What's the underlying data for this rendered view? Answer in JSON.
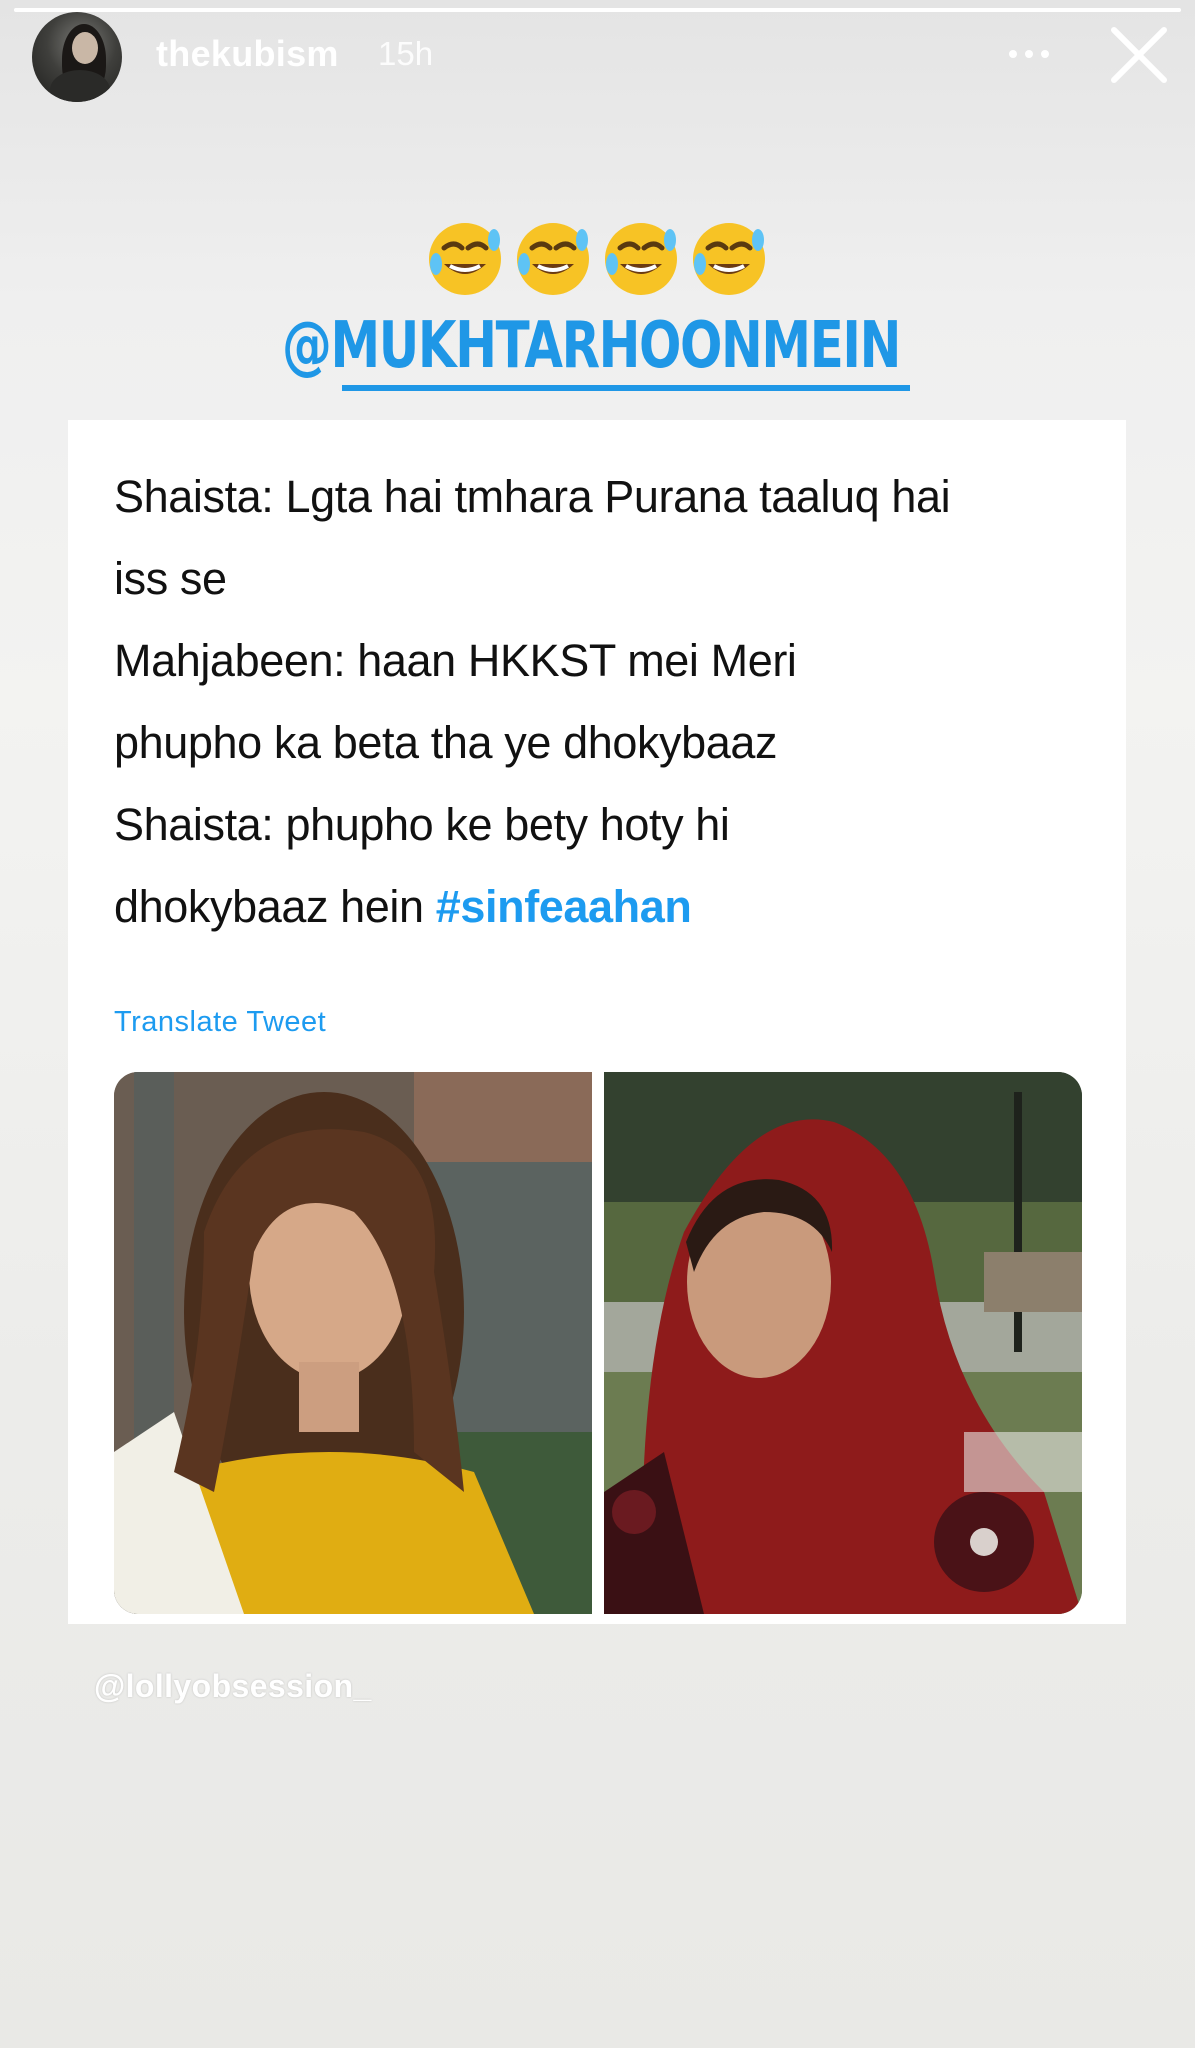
{
  "story": {
    "progress": 1.0
  },
  "header": {
    "username": "thekubism",
    "timestamp": "15h",
    "avatar_icon": "profile-avatar",
    "more_icon": "more-dots-icon",
    "close_icon": "close-icon"
  },
  "sticker": {
    "emojis": [
      "🤣",
      "🤣",
      "🤣",
      "🤣"
    ],
    "mention": "@MUKHTARHOONMEIN"
  },
  "tweet": {
    "lines": [
      "Shaista: Lgta hai tmhara Purana taaluq hai",
      "iss se",
      "Mahjabeen: haan HKKST mei Meri",
      "phupho ka beta tha ye dhokybaaz",
      "Shaista: phupho ke bety hoty hi",
      "dhokybaaz hein "
    ],
    "hashtag": "#sinfeaahan",
    "translate_label": "Translate Tweet",
    "hashtag_color": "#1d9bf0"
  },
  "caption": "@lollyobsession_",
  "colors": {
    "mention": "#1f97e6",
    "background": "#eeeeec"
  }
}
